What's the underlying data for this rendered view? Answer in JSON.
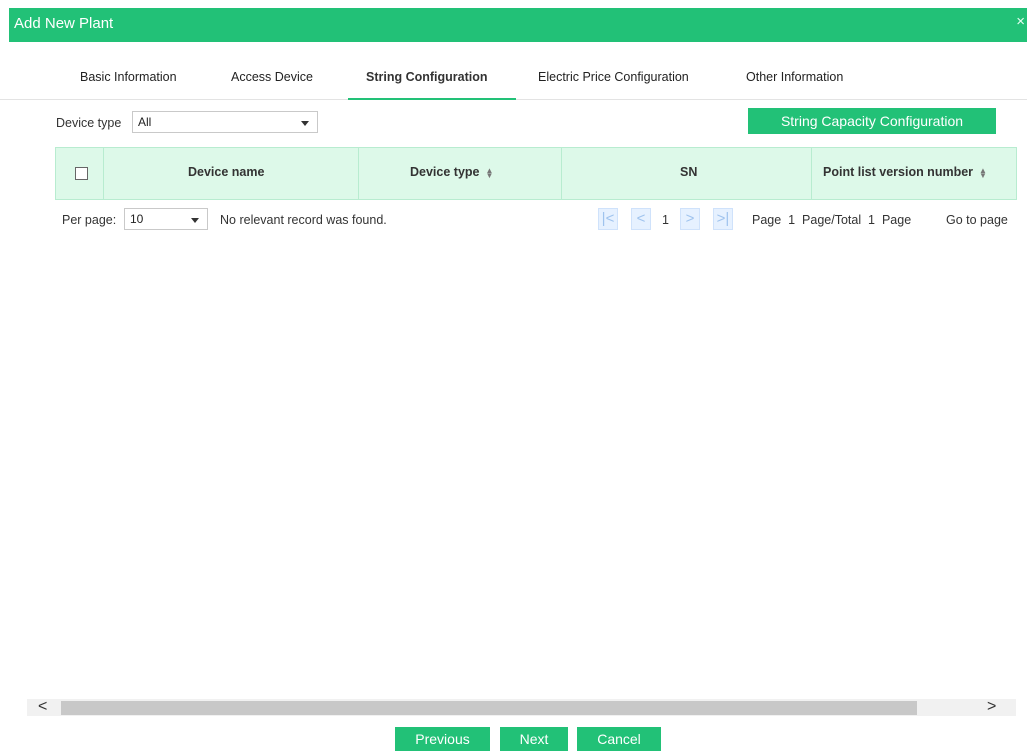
{
  "dialog": {
    "title": "Add New Plant",
    "close_glyph": "×"
  },
  "tabs": [
    {
      "label": "Basic Information"
    },
    {
      "label": "Access Device"
    },
    {
      "label": "String Configuration"
    },
    {
      "label": "Electric Price Configuration"
    },
    {
      "label": "Other Information"
    }
  ],
  "active_tab": "String Configuration",
  "filter": {
    "label": "Device type",
    "value": "All"
  },
  "actions": {
    "string_capacity_label": "String Capacity Configuration"
  },
  "table": {
    "columns": [
      {
        "label": "Device name",
        "sortable": false
      },
      {
        "label": "Device type",
        "sortable": true
      },
      {
        "label": "SN",
        "sortable": false
      },
      {
        "label": "Point list version number",
        "sortable": true
      }
    ],
    "rows": []
  },
  "pagination": {
    "per_page_label": "Per page:",
    "per_page_value": "10",
    "empty_message": "No relevant record was found.",
    "current_page": "1",
    "page_info": "Page  1  Page/Total  1  Page",
    "goto_label": "Go to page"
  },
  "footer": {
    "previous_label": "Previous",
    "next_label": "Next",
    "cancel_label": "Cancel"
  },
  "colors": {
    "accent": "#22c177",
    "header_bg": "#ddf9e9",
    "pager_btn": "#e6f1ff"
  },
  "icons": {
    "first_page": "first-page-icon",
    "prev_page": "prev-page-icon",
    "next_page": "next-page-icon",
    "last_page": "last-page-icon",
    "sort": "sort-icon",
    "scroll_left": "scroll-left-icon",
    "scroll_right": "scroll-right-icon"
  }
}
